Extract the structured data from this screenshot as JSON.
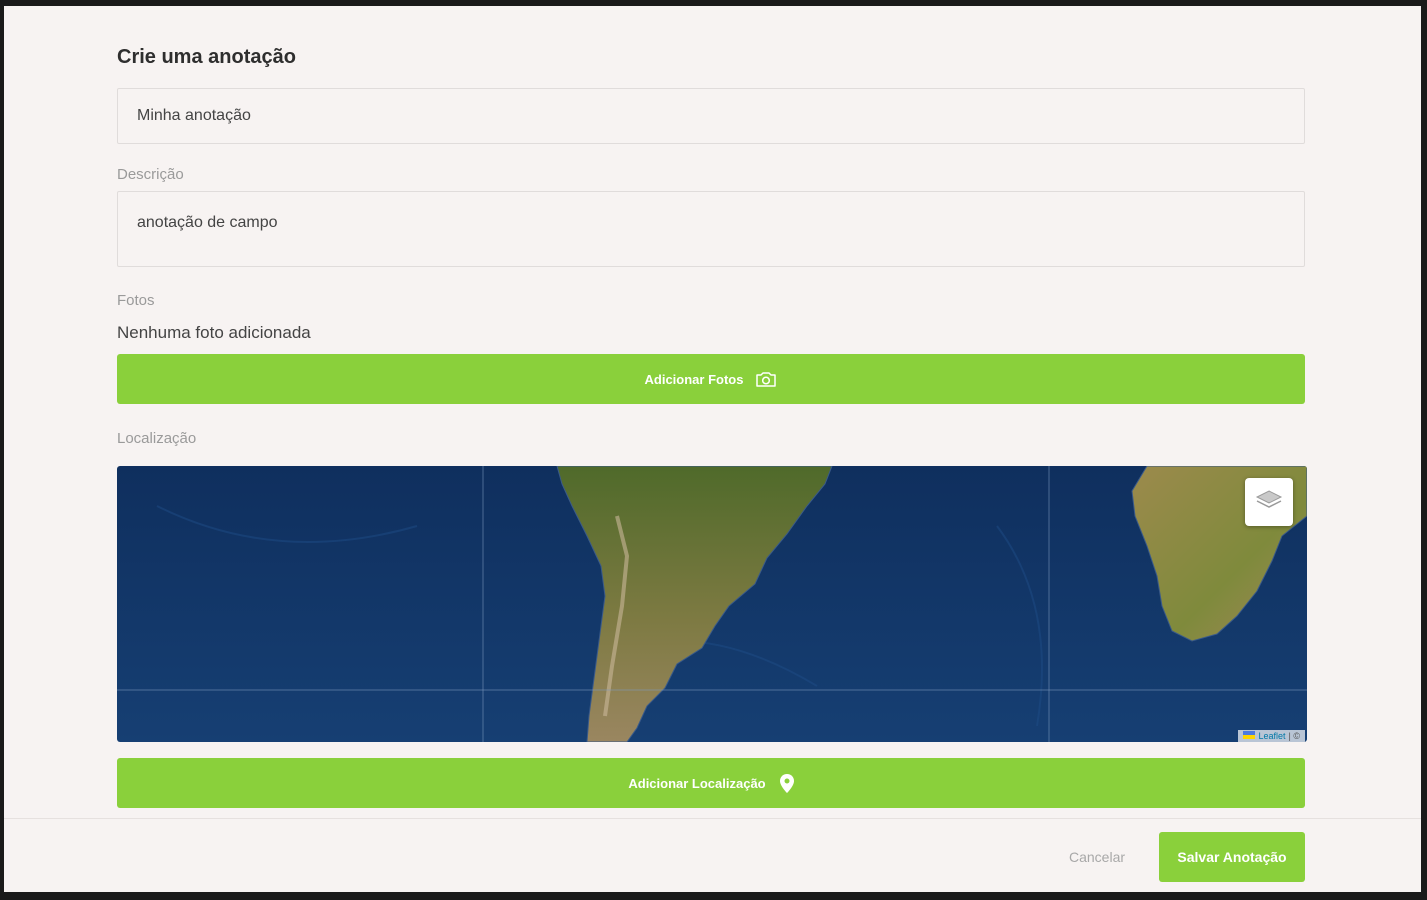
{
  "form": {
    "title": "Crie uma anotação",
    "name_value": "Minha anotação",
    "description_label": "Descrição",
    "description_value": "anotação de campo",
    "photos_label": "Fotos",
    "photos_empty": "Nenhuma foto adicionada",
    "add_photos_label": "Adicionar Fotos",
    "location_label": "Localização",
    "add_location_label": "Adicionar Localização"
  },
  "map": {
    "attribution_text": "Leaflet",
    "attribution_suffix": "| ©",
    "layers_icon": "layers-icon"
  },
  "footer": {
    "cancel_label": "Cancelar",
    "save_label": "Salvar Anotação"
  },
  "colors": {
    "accent": "#8ad03b",
    "background": "#f7f3f2",
    "ocean": "#123a6e"
  }
}
